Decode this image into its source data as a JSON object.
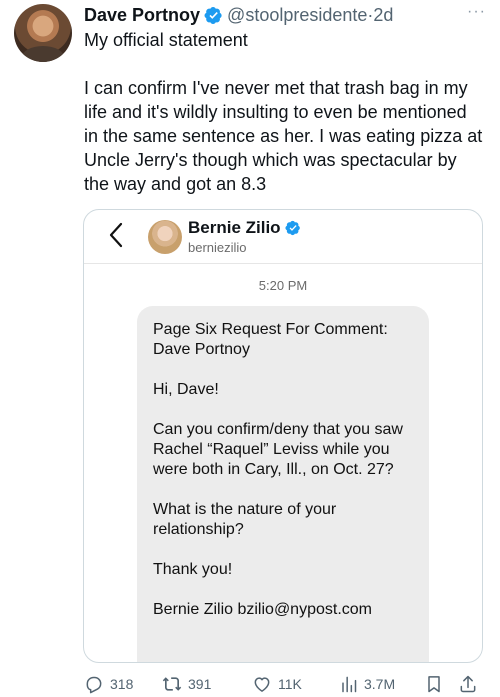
{
  "tweet": {
    "author_name": "Dave Portnoy",
    "handle": "@stoolpresidente",
    "separator": "·",
    "time": "2d",
    "more": "···",
    "paragraphs": [
      "My official statement",
      "I can confirm I've never met that trash bag in my life and it's wildly insulting to even be mentioned in the same sentence as her.  I was eating pizza at Uncle Jerry's though which was spectacular by the way and got an 8.3"
    ]
  },
  "embed": {
    "name": "Bernie Zilio",
    "username": "berniezilio",
    "message_time": "5:20 PM",
    "message_paragraphs": [
      "Page Six Request For Comment: Dave Portnoy",
      "Hi, Dave!",
      "Can you confirm/deny that you saw Rachel “Raquel” Leviss while you were both in Cary, Ill., on Oct. 27?",
      "What is the nature of your relationship?",
      "Thank you!",
      "Bernie Zilio bzilio@nypost.com"
    ]
  },
  "actions": {
    "replies": "318",
    "reposts": "391",
    "likes": "11K",
    "views": "3.7M"
  },
  "colors": {
    "verified": "#1d9bf0",
    "text": "#0f1419",
    "secondary": "#536471",
    "bubble": "#ececec"
  }
}
